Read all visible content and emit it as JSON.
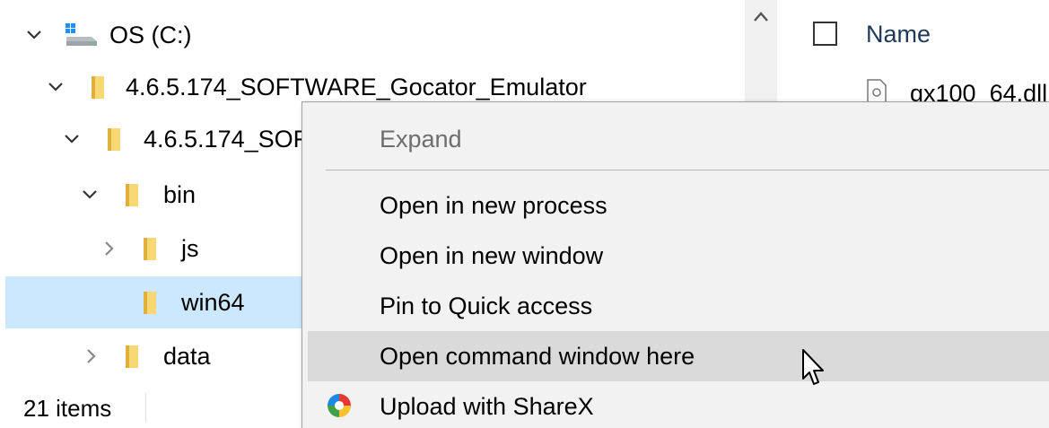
{
  "navigation_tree": {
    "items": [
      {
        "label": "OS (C:)",
        "expanded": true,
        "icon": "drive-icon"
      },
      {
        "label": "4.6.5.174_SOFTWARE_Gocator_Emulator",
        "expanded": true,
        "icon": "folder-icon"
      },
      {
        "label": "4.6.5.174_SOF",
        "expanded": true,
        "icon": "folder-icon"
      },
      {
        "label": "bin",
        "expanded": true,
        "icon": "folder-icon"
      },
      {
        "label": "js",
        "expanded": false,
        "icon": "folder-icon"
      },
      {
        "label": "win64",
        "selected": true,
        "icon": "folder-icon"
      },
      {
        "label": "data",
        "expanded": false,
        "icon": "folder-icon"
      }
    ]
  },
  "content": {
    "column_header": "Name",
    "file_name": "gx100_64.dll"
  },
  "status_bar": {
    "item_count": "21 items"
  },
  "context_menu": {
    "items": [
      {
        "label": "Expand",
        "disabled": true
      },
      {
        "label": "Open in new process"
      },
      {
        "label": "Open in new window"
      },
      {
        "label": "Pin to Quick access"
      },
      {
        "label": "Open command window here",
        "hovered": true
      },
      {
        "label": "Upload with ShareX",
        "icon": "sharex-icon"
      }
    ]
  },
  "colors": {
    "selection": "#cce8ff",
    "menu_background": "#f2f2f2",
    "menu_hover": "#dadada",
    "folder": "#f8d775",
    "header_text": "#1e395b"
  }
}
